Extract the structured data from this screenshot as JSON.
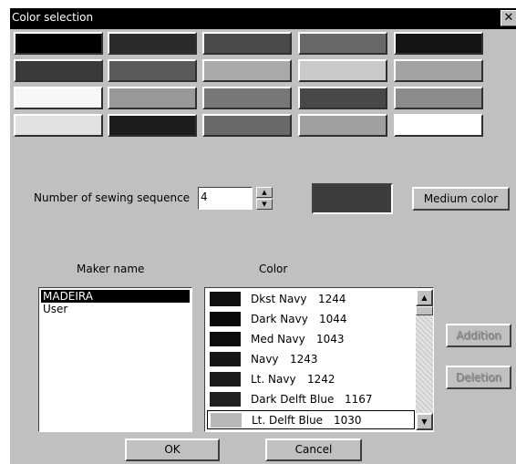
{
  "window": {
    "title": "Color selection",
    "close_glyph": "✕"
  },
  "palette": [
    [
      "#000000",
      "#2b2b2b",
      "#4a4a4a",
      "#686868",
      "#141414"
    ],
    [
      "#3a3a3a",
      "#5a5a5a",
      "#aaaaaa",
      "#cacaca",
      "#a3a3a3"
    ],
    [
      "#f7f7f7",
      "#989898",
      "#777777",
      "#484848",
      "#8c8c8c"
    ],
    [
      "#e2e2e2",
      "#1c1c1c",
      "#6a6a6a",
      "#a0a0a0",
      "#ffffff"
    ]
  ],
  "sequence": {
    "label": "Number of sewing sequence",
    "value": "4",
    "up_glyph": "▲",
    "down_glyph": "▼"
  },
  "preview": {
    "color": "#3c3c3c"
  },
  "buttons": {
    "medium_color": "Medium color",
    "addition": "Addition",
    "deletion": "Deletion",
    "ok": "OK",
    "cancel": "Cancel"
  },
  "maker": {
    "header": "Maker name",
    "items": [
      "MADEIRA",
      "User"
    ]
  },
  "colors": {
    "header": "Color",
    "items": [
      {
        "name": "Dkst Navy",
        "code": "1244",
        "chip": "#101010"
      },
      {
        "name": "Dark Navy",
        "code": "1044",
        "chip": "#0a0a0a"
      },
      {
        "name": "Med Navy",
        "code": "1043",
        "chip": "#0c0c0c"
      },
      {
        "name": "Navy",
        "code": "1243",
        "chip": "#161616"
      },
      {
        "name": "Lt. Navy",
        "code": "1242",
        "chip": "#1a1a1a"
      },
      {
        "name": "Dark Delft Blue",
        "code": "1167",
        "chip": "#202020"
      },
      {
        "name": "Lt. Delft Blue",
        "code": "1030",
        "chip": "#b8b8b8"
      }
    ]
  },
  "scroll": {
    "up_glyph": "▲",
    "down_glyph": "▼"
  }
}
